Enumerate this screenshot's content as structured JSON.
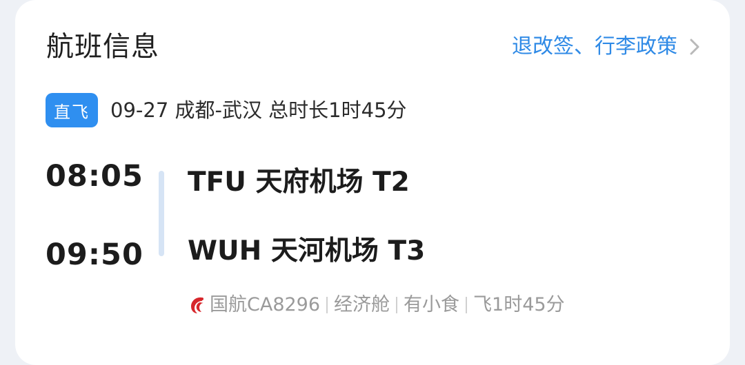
{
  "card": {
    "title": "航班信息",
    "policy_link": "退改签、行李政策"
  },
  "route": {
    "badge": "直飞",
    "summary": "09-27 成都-武汉 总时长1时45分"
  },
  "departure": {
    "time": "08:05",
    "airport": "TFU 天府机场 T2"
  },
  "arrival": {
    "time": "09:50",
    "airport": "WUH 天河机场 T3"
  },
  "details": {
    "airline_flight": "国航CA8296",
    "cabin": "经济舱",
    "meal": "有小食",
    "duration": "飞1时45分"
  },
  "colors": {
    "accent": "#2f8ae6",
    "badge": "#2f8ff0",
    "airline_logo": "#d7262b"
  },
  "icons": {
    "policy_chevron": "chevron-right-icon",
    "airline_logo": "air-china-logo-icon"
  }
}
